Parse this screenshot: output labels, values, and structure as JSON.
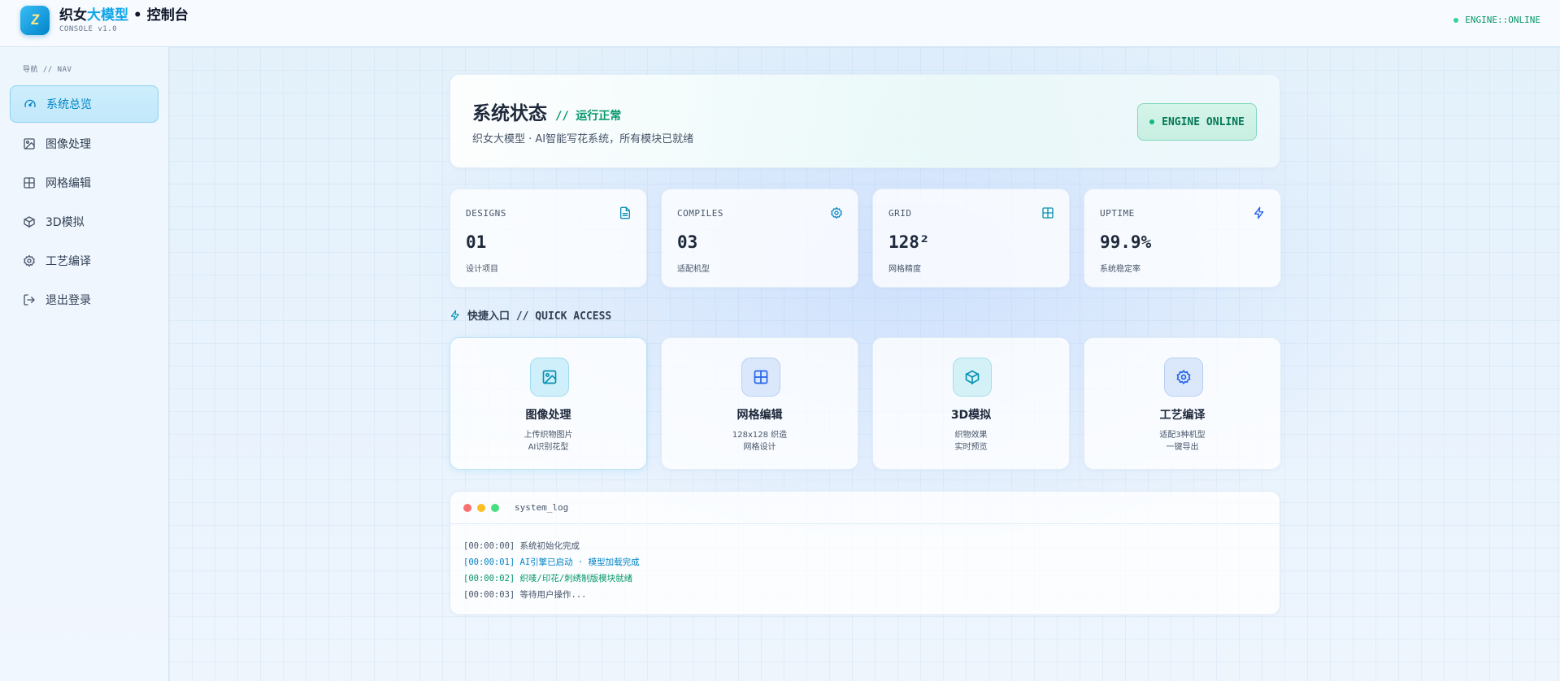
{
  "header": {
    "logo_glyph": "Z",
    "title_prefix": "织女",
    "title_accent": "大模型",
    "title_suffix": " • 控制台",
    "subtitle": "CONSOLE v1.0",
    "engine_status": "ENGINE::ONLINE"
  },
  "sidebar": {
    "title": "导航 // NAV",
    "items": [
      {
        "label": "系统总览",
        "icon": "gauge-icon",
        "active": true
      },
      {
        "label": "图像处理",
        "icon": "image-icon"
      },
      {
        "label": "网格编辑",
        "icon": "grid-icon"
      },
      {
        "label": "3D模拟",
        "icon": "cube-icon"
      },
      {
        "label": "工艺编译",
        "icon": "gear-icon"
      },
      {
        "label": "退出登录",
        "icon": "logout-icon"
      }
    ]
  },
  "hero": {
    "title": "系统状态",
    "tag": "// 运行正常",
    "subtitle": "织女大模型 · AI智能写花系统，所有模块已就绪",
    "engine_button": "ENGINE ONLINE"
  },
  "stats": [
    {
      "label": "DESIGNS",
      "value": "01",
      "desc": "设计项目",
      "icon": "document-icon"
    },
    {
      "label": "COMPILES",
      "value": "03",
      "desc": "适配机型",
      "icon": "gear-icon"
    },
    {
      "label": "GRID",
      "value": "128²",
      "desc": "网格精度",
      "icon": "grid-icon"
    },
    {
      "label": "UPTIME",
      "value": "99.9%",
      "desc": "系统稳定率",
      "icon": "bolt-icon"
    }
  ],
  "quick_access": {
    "title": "快捷入口 // QUICK ACCESS",
    "items": [
      {
        "title": "图像处理",
        "line1": "上传织物图片",
        "line2": "AI识别花型",
        "icon": "image-icon"
      },
      {
        "title": "网格编辑",
        "line1": "128x128 织造",
        "line2": "网格设计",
        "icon": "grid-icon"
      },
      {
        "title": "3D模拟",
        "line1": "织物效果",
        "line2": "实时预览",
        "icon": "cube-icon"
      },
      {
        "title": "工艺编译",
        "line1": "适配3种机型",
        "line2": "一键导出",
        "icon": "gear-icon"
      }
    ]
  },
  "log": {
    "name": "system_log",
    "lines": [
      {
        "text": "[00:00:00] 系统初始化完成",
        "color": "#475569"
      },
      {
        "text": "[00:00:01] AI引擎已启动 · 模型加载完成",
        "color": "#0284c7"
      },
      {
        "text": "[00:00:02] 织唛/印花/刺绣制版模块就绪",
        "color": "#059669"
      },
      {
        "text": "[00:00:03] 等待用户操作...",
        "color": "#475569"
      }
    ]
  },
  "colors": {
    "accent": "#0ea5e9",
    "success": "#059669",
    "traffic_red": "#f87171",
    "traffic_yellow": "#fbbf24",
    "traffic_green": "#4ade80"
  }
}
